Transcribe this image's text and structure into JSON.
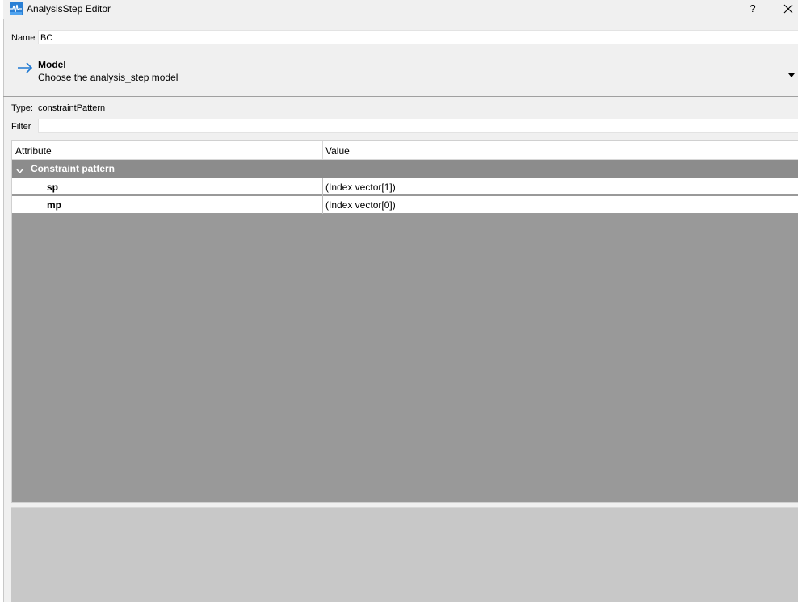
{
  "window": {
    "title": "AnalysisStep Editor",
    "help_label": "?"
  },
  "name": {
    "label": "Name",
    "value": "BC"
  },
  "model": {
    "title": "Model",
    "subtitle": "Choose the analysis_step model"
  },
  "type": {
    "label": "Type:",
    "value": "constraintPattern"
  },
  "filter": {
    "label": "Filter",
    "value": ""
  },
  "table": {
    "columns": [
      "Attribute",
      "Value"
    ],
    "group": "Constraint pattern",
    "rows": [
      {
        "attribute": "sp",
        "value": "(Index vector[1])"
      },
      {
        "attribute": "mp",
        "value": "(Index vector[0])"
      }
    ]
  },
  "colors": {
    "background": "#f0f0f0",
    "accent": "#1e78d2",
    "group_bg": "#8c8c8c",
    "tree_bg": "#999999",
    "bottom_panel": "#c8c8c8"
  },
  "icons": {
    "app": "app-waveform-icon",
    "close": "close-icon",
    "model": "arrow-right-icon",
    "dropdown": "dropdown-arrow-icon",
    "group": "chevron-down-icon"
  }
}
